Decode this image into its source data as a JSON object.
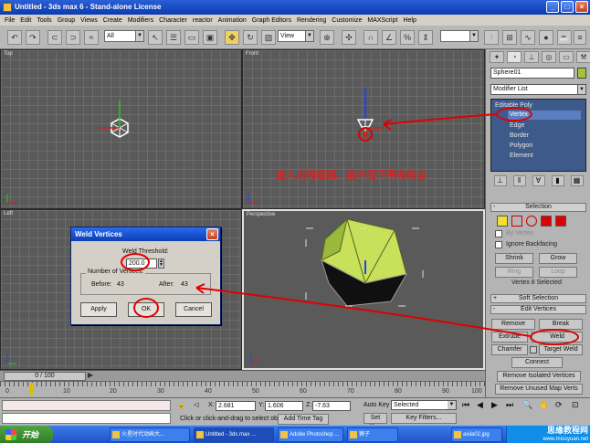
{
  "window": {
    "title": "Untitled - 3ds max 6 - Stand-alone License",
    "min": "_",
    "max": "□",
    "close": "×"
  },
  "menu": [
    "File",
    "Edit",
    "Tools",
    "Group",
    "Views",
    "Create",
    "Modifiers",
    "Character",
    "reactor",
    "Animation",
    "Graph Editors",
    "Rendering",
    "Customize",
    "MAXScript",
    "Help"
  ],
  "toolbar": {
    "selection_filter": "All",
    "ref_coord": "View"
  },
  "viewports": {
    "top": "Top",
    "front": "Front",
    "left": "Left",
    "perspective": "Perspective"
  },
  "annotation": {
    "text": "进入点的级别，选中底下所有的点"
  },
  "command_panel": {
    "object_name": "Sphere01",
    "object_color": "#a4c43a",
    "modifier_list": "Modifier List",
    "stack": [
      "Editable Poly",
      "Vertex",
      "Edge",
      "Border",
      "Polygon",
      "Element"
    ],
    "selection_title": "Selection",
    "by_vertex": "By Vertex",
    "ignore_backfacing": "Ignore Backfacing",
    "shrink": "Shrink",
    "grow": "Grow",
    "ring": "Ring",
    "loop": "Loop",
    "selection_status": "Vertex 8 Selected",
    "soft_selection": "Soft Selection",
    "edit_vertices": "Edit Vertices",
    "remove": "Remove",
    "break": "Break",
    "extrude": "Extrude",
    "weld": "Weld",
    "chamfer": "Chamfer",
    "target_weld": "Target Weld",
    "connect": "Connect",
    "remove_isolated": "Remove Isolated Vertices",
    "remove_unused": "Remove Unused Map Verts"
  },
  "dialog": {
    "title": "Weld Vertices",
    "threshold_label": "Weld Threshold:",
    "threshold_value": "200.0",
    "group_label": "Number of Vertices:",
    "before_label": "Before:",
    "before_value": "43",
    "after_label": "After:",
    "after_value": "43",
    "apply": "Apply",
    "ok": "OK",
    "cancel": "Cancel"
  },
  "timeline": {
    "slider": "0 / 100",
    "ticks": [
      "0",
      "10",
      "20",
      "30",
      "40",
      "50",
      "60",
      "70",
      "80",
      "90",
      "100"
    ]
  },
  "status": {
    "x_label": "X:",
    "x": "2.681",
    "y_label": "Y:",
    "y": "1.606",
    "z_label": "Z:",
    "z": "-7.63",
    "prompt": "Click or click-and-drag to select obj",
    "add_time_tag": "Add Time Tag",
    "auto_key": "Auto Key",
    "selected": "Selected",
    "set_key": "Set Key",
    "key_filters": "Key Filters..."
  },
  "taskbar": {
    "start": "开始",
    "tasks": [
      "火星时代动画大...",
      "Untitled - 3ds max ...",
      "Adobe Photoshop ...",
      "狮子",
      "axila02.jpg"
    ],
    "watermark": "思缘教程网",
    "watermark_url": "www.missyuan.net"
  }
}
